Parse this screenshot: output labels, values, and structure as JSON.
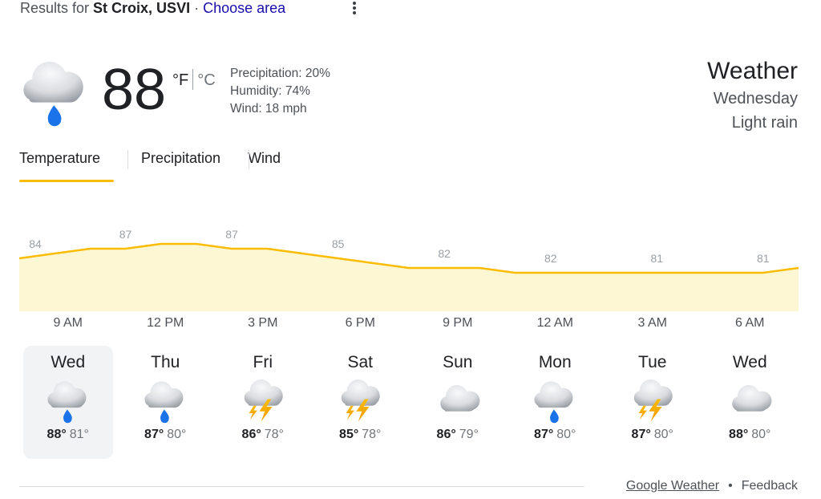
{
  "header": {
    "results_prefix": "Results for",
    "location": "St Croix, USVI",
    "separator": "·",
    "choose_area": "Choose area"
  },
  "current": {
    "temperature": "88",
    "unit_f": "°F",
    "unit_c": "°C",
    "precipitation": "Precipitation: 20%",
    "humidity": "Humidity: 74%",
    "wind": "Wind: 18 mph",
    "icon": "rain-cloud-icon"
  },
  "summary": {
    "title": "Weather",
    "day": "Wednesday",
    "condition": "Light rain"
  },
  "tabs": [
    {
      "label": "Temperature",
      "active": true
    },
    {
      "label": "Precipitation",
      "active": false
    },
    {
      "label": "Wind",
      "active": false
    }
  ],
  "chart_data": {
    "type": "area",
    "series": [
      {
        "values": [
          84,
          85,
          86,
          86,
          87,
          87,
          86,
          86,
          85,
          84,
          83,
          82,
          82,
          82,
          81,
          81,
          81,
          81,
          81,
          81,
          81,
          81,
          82
        ]
      }
    ],
    "labels": [
      {
        "hour_index": 0,
        "value": "84"
      },
      {
        "hour_index": 3,
        "value": "87"
      },
      {
        "hour_index": 6,
        "value": "87"
      },
      {
        "hour_index": 9,
        "value": "85"
      },
      {
        "hour_index": 12,
        "value": "82"
      },
      {
        "hour_index": 15,
        "value": "82"
      },
      {
        "hour_index": 18,
        "value": "81"
      },
      {
        "hour_index": 21,
        "value": "81"
      }
    ],
    "x_labels": [
      "9 AM",
      "12 PM",
      "3 PM",
      "6 PM",
      "9 PM",
      "12 AM",
      "3 AM",
      "6 AM"
    ],
    "ylim": [
      75,
      90
    ],
    "colors": {
      "line": "#fbbc04",
      "fill": "#fef7d4",
      "label": "#9aa0a6"
    }
  },
  "days": [
    {
      "name": "Wed",
      "high": "88°",
      "low": "81°",
      "icon": "rain-cloud-icon",
      "selected": true
    },
    {
      "name": "Thu",
      "high": "87°",
      "low": "80°",
      "icon": "rain-cloud-icon",
      "selected": false
    },
    {
      "name": "Fri",
      "high": "86°",
      "low": "78°",
      "icon": "thunderstorm-icon",
      "selected": false
    },
    {
      "name": "Sat",
      "high": "85°",
      "low": "78°",
      "icon": "thunderstorm-icon",
      "selected": false
    },
    {
      "name": "Sun",
      "high": "86°",
      "low": "79°",
      "icon": "cloud-icon",
      "selected": false
    },
    {
      "name": "Mon",
      "high": "87°",
      "low": "80°",
      "icon": "rain-cloud-icon",
      "selected": false
    },
    {
      "name": "Tue",
      "high": "87°",
      "low": "80°",
      "icon": "thunderstorm-icon",
      "selected": false
    },
    {
      "name": "Wed",
      "high": "88°",
      "low": "80°",
      "icon": "cloud-icon",
      "selected": false
    }
  ],
  "footer": {
    "google_weather": "Google Weather",
    "dot": "•",
    "feedback": "Feedback"
  }
}
